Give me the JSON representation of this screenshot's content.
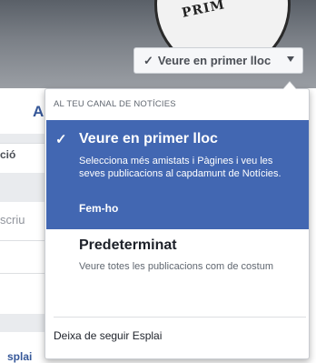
{
  "cover": {
    "logo_text": "PRIM",
    "follow_button": {
      "label": "Veure en primer lloc"
    }
  },
  "background_fragments": {
    "nav_letter": "A",
    "tab_fragment": "ció",
    "input_fragment": "scriu",
    "footer_fragment": "splai"
  },
  "dropdown": {
    "header": "AL TEU CANAL DE NOTÍCIES",
    "options": [
      {
        "title": "Veure en primer lloc",
        "description": "Selecciona més amistats i Pàgines i veu les seves publicacions al capdamunt de Notícies.",
        "action": "Fem-ho",
        "selected": true
      },
      {
        "title": "Predeterminat",
        "description": "Veure totes les publicacions com de costum",
        "selected": false
      }
    ],
    "unfollow_label": "Deixa de seguir Esplai"
  },
  "colors": {
    "selected_bg": "#4267b2",
    "page_bg": "#e9ebee"
  }
}
